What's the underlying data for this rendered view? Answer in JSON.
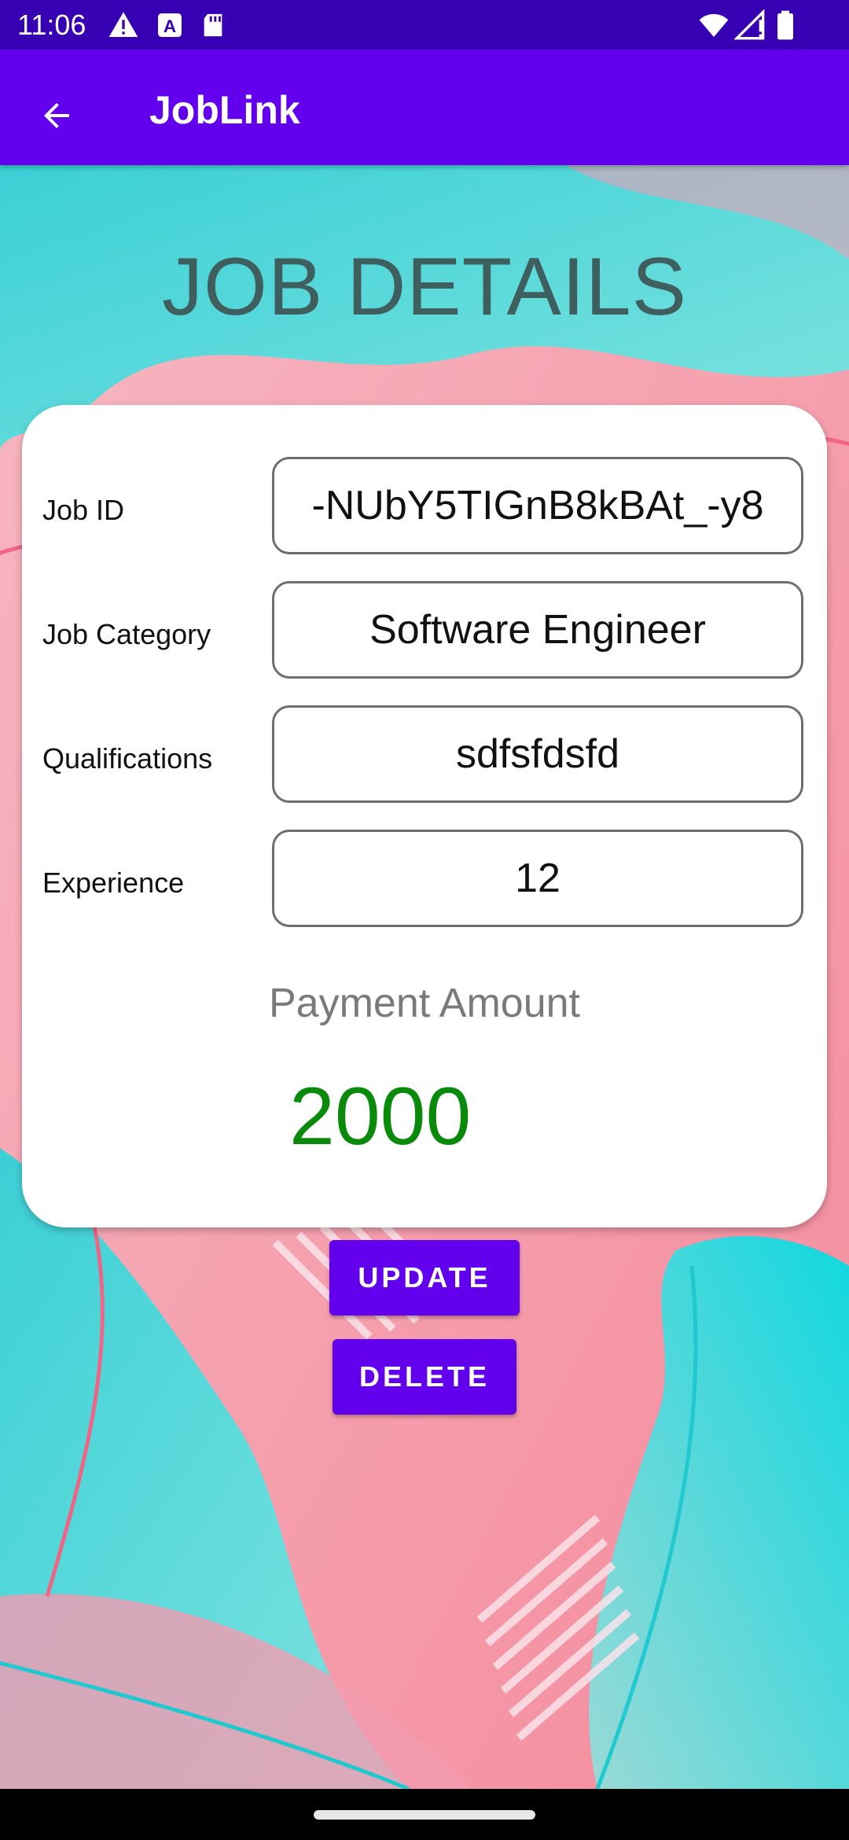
{
  "status_bar": {
    "time": "11:06",
    "icons": [
      "alert-icon",
      "a-notification-icon",
      "sd-card-icon",
      "wifi-icon",
      "signal-icon",
      "battery-icon"
    ]
  },
  "app_bar": {
    "title": "JobLink",
    "back_icon": "arrow-left-icon"
  },
  "page": {
    "heading": "JOB DETAILS"
  },
  "fields": [
    {
      "label": "Job ID",
      "value": "-NUbY5TIGnB8kBAt_-y8"
    },
    {
      "label": "Job Category",
      "value": "Software Engineer"
    },
    {
      "label": "Qualifications",
      "value": "sdfsfdsfd"
    },
    {
      "label": "Experience",
      "value": "12"
    }
  ],
  "payment": {
    "label": "Payment Amount",
    "value": "2000"
  },
  "actions": {
    "update_label": "UPDATE",
    "delete_label": "DELETE"
  },
  "colors": {
    "status_bar": "#3700b3",
    "app_bar": "#6200ee",
    "heading": "#3f5f5f",
    "payment_value": "#0a8a0a",
    "button": "#6200ee",
    "background_pink": "#f6a6b2",
    "background_teal": "#3fd6d6"
  }
}
